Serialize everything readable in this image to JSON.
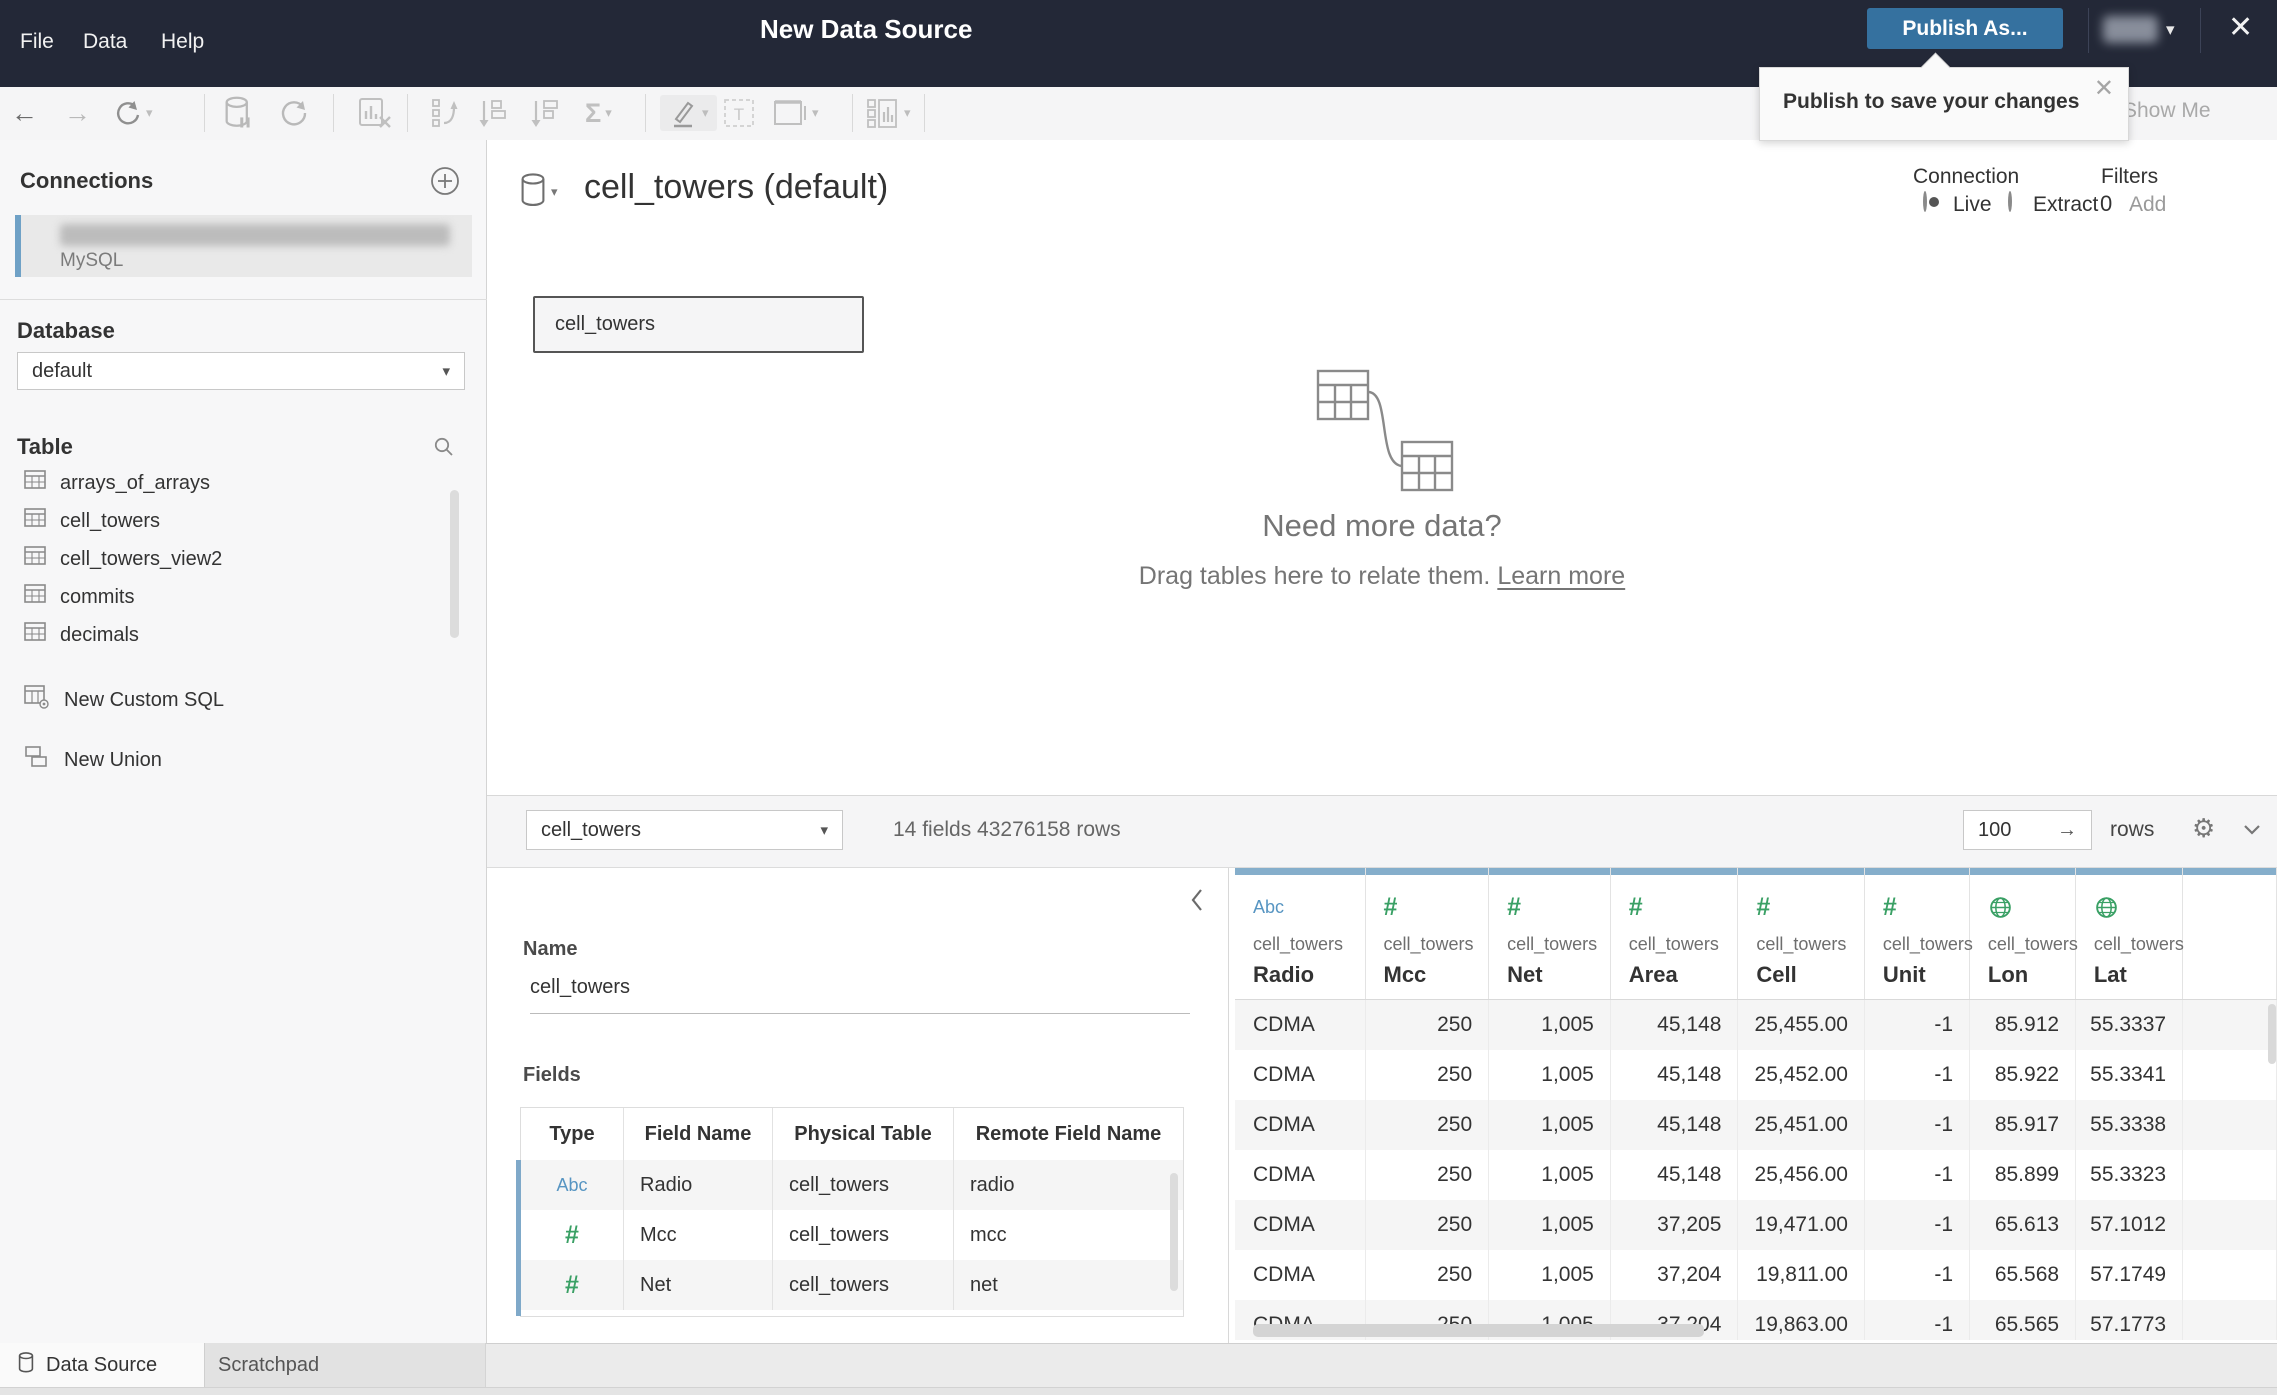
{
  "topbar": {
    "title": "New Data Source",
    "menus": [
      "File",
      "Data",
      "Help"
    ],
    "publish_label": "Publish As...",
    "close_glyph": "✕",
    "user_caret": "▾"
  },
  "tooltip": {
    "text": "Publish to save your changes",
    "close_glyph": "✕"
  },
  "toolbar": {
    "show_me": "Show Me",
    "icons": [
      "back",
      "forward",
      "redo",
      "pause-auto-updates",
      "run-update",
      "clear-sheet",
      "swap-rows-columns",
      "sort-ascending",
      "sort-descending",
      "totals",
      "highlight",
      "annotate",
      "fit",
      "show-cards"
    ],
    "glyphs": {
      "back": "←",
      "forward": "→",
      "sigma": "Σ",
      "gear": "⚙"
    }
  },
  "sidebar": {
    "connections_title": "Connections",
    "connection_type": "MySQL",
    "database_label": "Database",
    "database_value": "default",
    "table_label": "Table",
    "tables": [
      "arrays_of_arrays",
      "cell_towers",
      "cell_towers_view2",
      "commits",
      "decimals"
    ],
    "actions": [
      "New Custom SQL",
      "New Union"
    ]
  },
  "canvas": {
    "datasource_title": "cell_towers (default)",
    "logical_table": "cell_towers",
    "connection_label": "Connection",
    "live_label": "Live",
    "extract_label": "Extract",
    "filters_label": "Filters",
    "filters_count": "0",
    "filters_add": "Add",
    "empty_title": "Need more data?",
    "empty_sub": "Drag tables here to relate them. ",
    "empty_link": "Learn more"
  },
  "bottom_header": {
    "table_select_value": "cell_towers",
    "summary": "14 fields 43276158 rows",
    "row_count": "100",
    "rows_label": "rows",
    "arrow_glyph": "→"
  },
  "metadata": {
    "name_label": "Name",
    "name_value": "cell_towers",
    "fields_label": "Fields",
    "columns": [
      "Type",
      "Field Name",
      "Physical Table",
      "Remote Field Name"
    ],
    "rows": [
      {
        "type": "string",
        "field": "Radio",
        "table": "cell_towers",
        "remote": "radio"
      },
      {
        "type": "number",
        "field": "Mcc",
        "table": "cell_towers",
        "remote": "mcc"
      },
      {
        "type": "number",
        "field": "Net",
        "table": "cell_towers",
        "remote": "net"
      }
    ]
  },
  "grid": {
    "columns": [
      {
        "type": "string",
        "table": "cell_towers",
        "name": "Radio"
      },
      {
        "type": "number",
        "table": "cell_towers",
        "name": "Mcc"
      },
      {
        "type": "number",
        "table": "cell_towers",
        "name": "Net"
      },
      {
        "type": "number",
        "table": "cell_towers",
        "name": "Area"
      },
      {
        "type": "number",
        "table": "cell_towers",
        "name": "Cell"
      },
      {
        "type": "number",
        "table": "cell_towers",
        "name": "Unit"
      },
      {
        "type": "geo",
        "table": "cell_towers",
        "name": "Lon"
      },
      {
        "type": "geo",
        "table": "cell_towers",
        "name": "Lat"
      }
    ],
    "rows": [
      [
        "CDMA",
        "250",
        "1,005",
        "45,148",
        "25,455.00",
        "-1",
        "85.912",
        "55.3337"
      ],
      [
        "CDMA",
        "250",
        "1,005",
        "45,148",
        "25,452.00",
        "-1",
        "85.922",
        "55.3341"
      ],
      [
        "CDMA",
        "250",
        "1,005",
        "45,148",
        "25,451.00",
        "-1",
        "85.917",
        "55.3338"
      ],
      [
        "CDMA",
        "250",
        "1,005",
        "45,148",
        "25,456.00",
        "-1",
        "85.899",
        "55.3323"
      ],
      [
        "CDMA",
        "250",
        "1,005",
        "37,205",
        "19,471.00",
        "-1",
        "65.613",
        "57.1012"
      ],
      [
        "CDMA",
        "250",
        "1,005",
        "37,204",
        "19,811.00",
        "-1",
        "65.568",
        "57.1749"
      ],
      [
        "CDMA",
        "250",
        "1,005",
        "37,204",
        "19,863.00",
        "-1",
        "65.565",
        "57.1773"
      ]
    ]
  },
  "tabs": {
    "data_source": "Data Source",
    "scratchpad": "Scratchpad"
  },
  "colors": {
    "topbar": "#232837",
    "publish_blue": "#35719f",
    "header_accent": "#85aecb",
    "number_green": "#3aa065",
    "string_blue": "#5795c2"
  }
}
